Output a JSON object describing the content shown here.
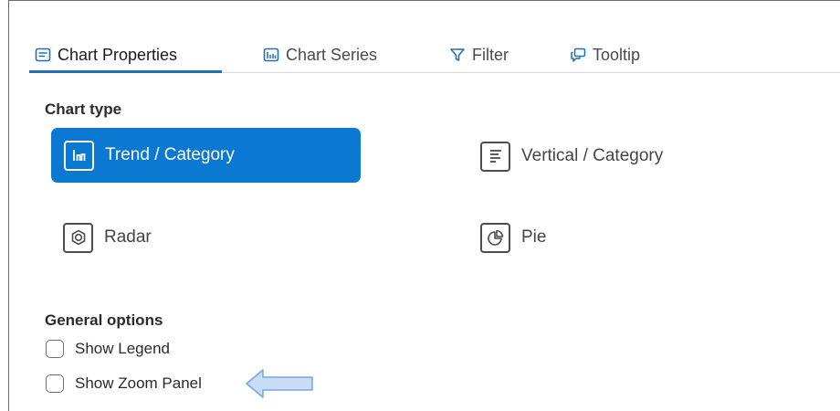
{
  "tabs": [
    {
      "label": "Chart Properties",
      "icon": "chart-properties-icon",
      "active": true
    },
    {
      "label": "Chart Series",
      "icon": "chart-series-icon",
      "active": false
    },
    {
      "label": "Filter",
      "icon": "filter-icon",
      "active": false
    },
    {
      "label": "Tooltip",
      "icon": "tooltip-icon",
      "active": false
    }
  ],
  "chart_type": {
    "heading": "Chart type",
    "options": [
      {
        "label": "Trend / Category",
        "icon": "trend-category-icon",
        "selected": true
      },
      {
        "label": "Vertical / Category",
        "icon": "vertical-category-icon",
        "selected": false
      },
      {
        "label": "Radar",
        "icon": "radar-icon",
        "selected": false
      },
      {
        "label": "Pie",
        "icon": "pie-icon",
        "selected": false
      }
    ]
  },
  "general_options": {
    "heading": "General options",
    "checkboxes": [
      {
        "label": "Show Legend",
        "checked": false
      },
      {
        "label": "Show Zoom Panel",
        "checked": false
      }
    ]
  },
  "colors": {
    "accent": "#0b78d1",
    "tab_underline": "#1f6fb5",
    "arrow_fill": "#c9dcf5",
    "arrow_stroke": "#7aa4dc"
  }
}
